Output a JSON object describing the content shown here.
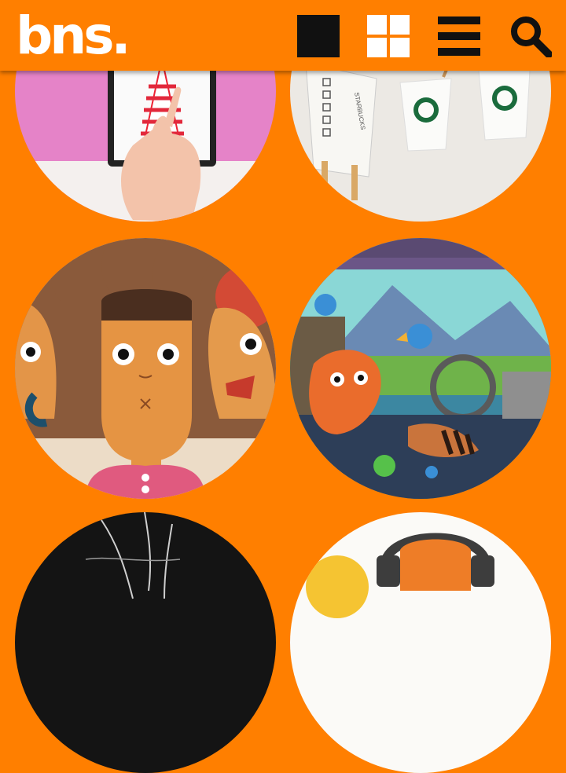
{
  "header": {
    "logo_text": "bns.",
    "icons": [
      "single-view-icon",
      "grid-view-icon",
      "list-view-icon",
      "search-icon"
    ]
  },
  "tiles": [
    {
      "name": "tile-ipad-illustration"
    },
    {
      "name": "tile-starbucks-cups"
    },
    {
      "name": "tile-cartoon-faces"
    },
    {
      "name": "tile-cartoon-car"
    },
    {
      "name": "tile-dark-sketch"
    },
    {
      "name": "tile-headphones"
    }
  ],
  "tile_texts": {
    "starbucks_label": "STARBUCKS"
  },
  "colors": {
    "brand": "#ff7f00",
    "logo": "#ffffff",
    "icon": "#111111"
  }
}
